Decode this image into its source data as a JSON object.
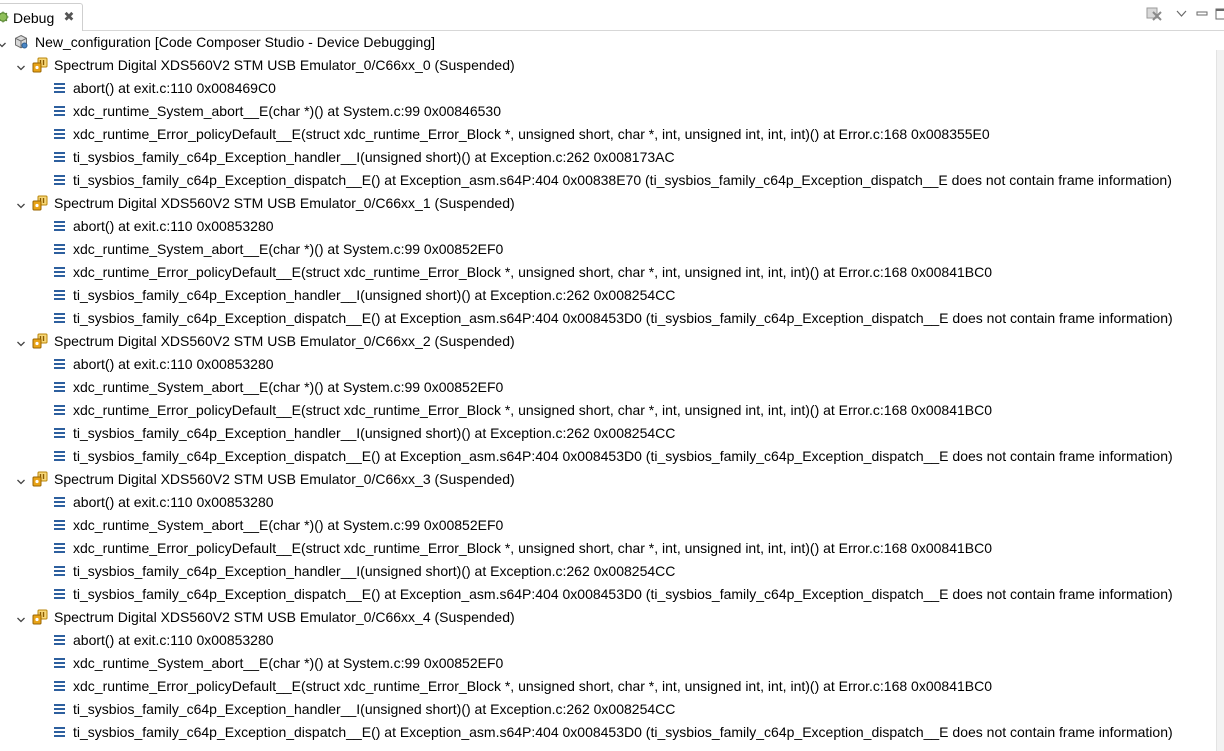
{
  "tab": {
    "title": "Debug",
    "icon": "debug-bug-icon",
    "close_icon": "close-icon",
    "close_glyph": "✖"
  },
  "toolbar": {
    "buttons": [
      {
        "name": "remove-all-terminated-button",
        "icon": "remove-terminated-icon"
      },
      {
        "name": "view-menu-button",
        "icon": "chevron-down-icon"
      },
      {
        "name": "minimize-button",
        "icon": "minimize-icon"
      },
      {
        "name": "maximize-button",
        "icon": "maximize-icon"
      }
    ]
  },
  "tree": {
    "root": {
      "label": "New_configuration [Code Composer Studio - Device Debugging]",
      "icon": "launch-configuration-icon",
      "expanded": true
    },
    "threads": [
      {
        "label": "Spectrum Digital XDS560V2 STM USB Emulator_0/C66xx_0 (Suspended)",
        "icon": "suspended-target-icon",
        "expanded": true,
        "frames": [
          "abort() at exit.c:110 0x008469C0",
          "xdc_runtime_System_abort__E(char *)() at System.c:99 0x00846530",
          "xdc_runtime_Error_policyDefault__E(struct xdc_runtime_Error_Block *, unsigned short, char *, int, unsigned int, int, int)() at Error.c:168 0x008355E0",
          "ti_sysbios_family_c64p_Exception_handler__I(unsigned short)() at Exception.c:262 0x008173AC",
          "ti_sysbios_family_c64p_Exception_dispatch__E() at Exception_asm.s64P:404 0x00838E70  (ti_sysbios_family_c64p_Exception_dispatch__E does not contain frame information)"
        ]
      },
      {
        "label": "Spectrum Digital XDS560V2 STM USB Emulator_0/C66xx_1 (Suspended)",
        "icon": "suspended-target-icon",
        "expanded": true,
        "frames": [
          "abort() at exit.c:110 0x00853280",
          "xdc_runtime_System_abort__E(char *)() at System.c:99 0x00852EF0",
          "xdc_runtime_Error_policyDefault__E(struct xdc_runtime_Error_Block *, unsigned short, char *, int, unsigned int, int, int)() at Error.c:168 0x00841BC0",
          "ti_sysbios_family_c64p_Exception_handler__I(unsigned short)() at Exception.c:262 0x008254CC",
          "ti_sysbios_family_c64p_Exception_dispatch__E() at Exception_asm.s64P:404 0x008453D0  (ti_sysbios_family_c64p_Exception_dispatch__E does not contain frame information)"
        ]
      },
      {
        "label": "Spectrum Digital XDS560V2 STM USB Emulator_0/C66xx_2 (Suspended)",
        "icon": "suspended-target-icon",
        "expanded": true,
        "frames": [
          "abort() at exit.c:110 0x00853280",
          "xdc_runtime_System_abort__E(char *)() at System.c:99 0x00852EF0",
          "xdc_runtime_Error_policyDefault__E(struct xdc_runtime_Error_Block *, unsigned short, char *, int, unsigned int, int, int)() at Error.c:168 0x00841BC0",
          "ti_sysbios_family_c64p_Exception_handler__I(unsigned short)() at Exception.c:262 0x008254CC",
          "ti_sysbios_family_c64p_Exception_dispatch__E() at Exception_asm.s64P:404 0x008453D0  (ti_sysbios_family_c64p_Exception_dispatch__E does not contain frame information)"
        ]
      },
      {
        "label": "Spectrum Digital XDS560V2 STM USB Emulator_0/C66xx_3 (Suspended)",
        "icon": "suspended-target-icon",
        "expanded": true,
        "frames": [
          "abort() at exit.c:110 0x00853280",
          "xdc_runtime_System_abort__E(char *)() at System.c:99 0x00852EF0",
          "xdc_runtime_Error_policyDefault__E(struct xdc_runtime_Error_Block *, unsigned short, char *, int, unsigned int, int, int)() at Error.c:168 0x00841BC0",
          "ti_sysbios_family_c64p_Exception_handler__I(unsigned short)() at Exception.c:262 0x008254CC",
          "ti_sysbios_family_c64p_Exception_dispatch__E() at Exception_asm.s64P:404 0x008453D0  (ti_sysbios_family_c64p_Exception_dispatch__E does not contain frame information)"
        ]
      },
      {
        "label": "Spectrum Digital XDS560V2 STM USB Emulator_0/C66xx_4 (Suspended)",
        "icon": "suspended-target-icon",
        "expanded": true,
        "frames": [
          "abort() at exit.c:110 0x00853280",
          "xdc_runtime_System_abort__E(char *)() at System.c:99 0x00852EF0",
          "xdc_runtime_Error_policyDefault__E(struct xdc_runtime_Error_Block *, unsigned short, char *, int, unsigned int, int, int)() at Error.c:168 0x00841BC0",
          "ti_sysbios_family_c64p_Exception_handler__I(unsigned short)() at Exception.c:262 0x008254CC",
          "ti_sysbios_family_c64p_Exception_dispatch__E() at Exception_asm.s64P:404 0x008453D0  (ti_sysbios_family_c64p_Exception_dispatch__E does not contain frame information)"
        ]
      }
    ],
    "frame_icon": "stack-frame-icon"
  },
  "colors": {
    "text": "#000000",
    "frame_icon": "#2d5f9e",
    "suspended_icon": "#e8a317",
    "tab_border": "#cfcfcf"
  }
}
